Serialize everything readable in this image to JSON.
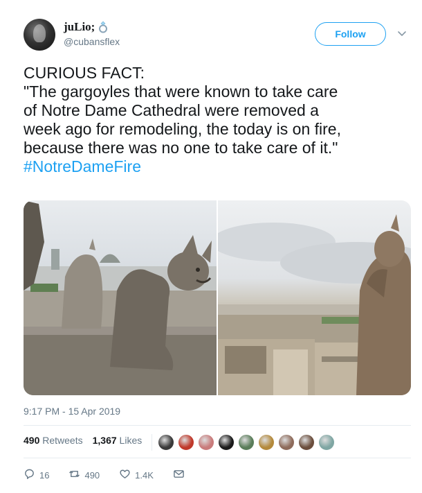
{
  "user": {
    "display_name": "juLio;",
    "handle": "@cubansflex",
    "follow_label": "Follow"
  },
  "tweet": {
    "lines": [
      "CURIOUS FACT:",
      "\"The gargoyles that were known to take care",
      "of Notre Dame Cathedral were removed a",
      "week ago for remodeling, the today is on fire,",
      "because there was no one to take care of it.\""
    ],
    "hashtag": "#NotreDameFire"
  },
  "timestamp": "9:17 PM - 15 Apr 2019",
  "stats": {
    "retweets_count": "490",
    "retweets_label": "Retweets",
    "likes_count": "1,367",
    "likes_label": "Likes"
  },
  "likers": [
    {
      "color": "#3a3a3a"
    },
    {
      "color": "#c0392b"
    },
    {
      "color": "#c97b7b"
    },
    {
      "color": "#1b1b1b"
    },
    {
      "color": "#5a7d5a"
    },
    {
      "color": "#b48a3c"
    },
    {
      "color": "#8e6b5b"
    },
    {
      "color": "#6b4e3d"
    },
    {
      "color": "#7fa6a3"
    }
  ],
  "actions": {
    "replies": "16",
    "retweets": "490",
    "likes": "1.4K"
  },
  "colors": {
    "accent": "#1da1f2",
    "muted": "#657786",
    "text": "#14171a"
  },
  "icons": [
    "ring-icon",
    "chevron-down-icon",
    "reply-icon",
    "retweet-icon",
    "heart-icon",
    "mail-icon"
  ]
}
